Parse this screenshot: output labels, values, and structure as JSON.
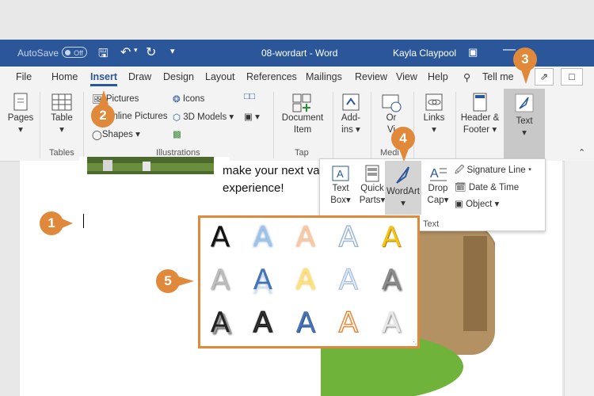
{
  "titlebar": {
    "autosave_label": "AutoSave",
    "autosave_state": "Off",
    "doc_title": "08-wordart - Word",
    "user": "Kayla Claypool"
  },
  "tabs": [
    "File",
    "Home",
    "Insert",
    "Draw",
    "Design",
    "Layout",
    "References",
    "Mailings",
    "Review",
    "View",
    "Help"
  ],
  "tell_me": "Tell me",
  "ribbon": {
    "pages": "Pages",
    "table": "Table",
    "tables_group": "Tables",
    "pictures": "Pictures",
    "online_pictures": "Online Pictures",
    "shapes": "Shapes",
    "icons": "Icons",
    "models": "3D Models",
    "illustrations_group": "Illustrations",
    "document_item": [
      "Document",
      "Item"
    ],
    "tap_group": "Tap",
    "addins": [
      "Add-",
      "ins"
    ],
    "online_video": [
      "Or",
      "Vi"
    ],
    "media_group": "Medi",
    "links": "Links",
    "header_footer": [
      "Header &",
      "Footer"
    ],
    "text": "Text"
  },
  "document": {
    "line1": "make your next va",
    "line2": "experience!"
  },
  "text_menu": {
    "text_box": [
      "Text",
      "Box"
    ],
    "quick_parts": [
      "Quick",
      "Parts"
    ],
    "wordart": "WordArt",
    "drop_cap": [
      "Drop",
      "Cap"
    ],
    "signature_line": "Signature Line",
    "date_time": "Date & Time",
    "object": "Object",
    "group_label": "Text"
  },
  "wordart_letter": "A",
  "callouts": [
    "1",
    "2",
    "3",
    "4",
    "5"
  ],
  "colors": {
    "accent": "#2b579a",
    "callout": "#e0893a"
  }
}
